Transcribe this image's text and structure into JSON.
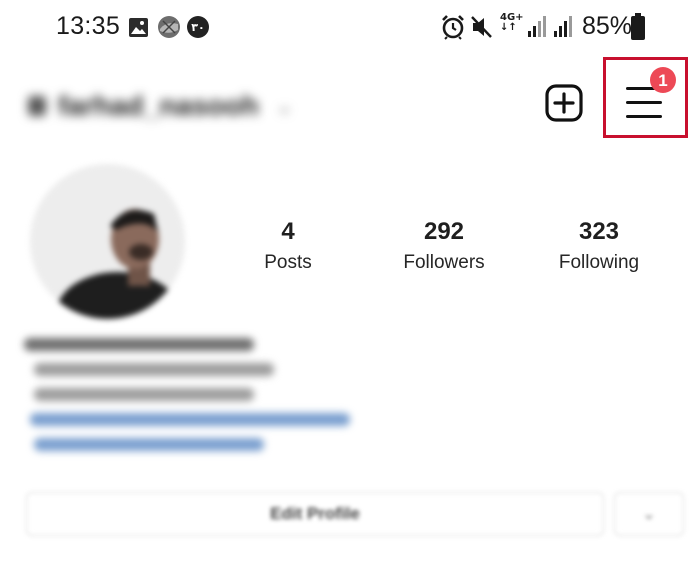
{
  "status_bar": {
    "time": "13:35",
    "battery_percent": "85%",
    "network_type": "4G+",
    "icons": [
      "image-icon",
      "photo-thumbnail-icon",
      "notification-badge-icon",
      "alarm-icon",
      "mute-icon",
      "network-4g-icon",
      "signal-icon",
      "signal-icon",
      "battery-icon"
    ]
  },
  "header": {
    "username": "farhad_nasooh",
    "new_post_icon": "plus-square-icon",
    "menu_icon": "hamburger-menu-icon",
    "menu_badge_count": "1",
    "badge_color": "#ed4956",
    "highlight_color": "#c8102e"
  },
  "profile": {
    "stats": [
      {
        "count": "4",
        "label": "Posts"
      },
      {
        "count": "292",
        "label": "Followers"
      },
      {
        "count": "323",
        "label": "Following"
      }
    ]
  },
  "actions": {
    "edit_profile_label": "Edit Profile",
    "suggest_icon": "chevron-down-icon"
  }
}
